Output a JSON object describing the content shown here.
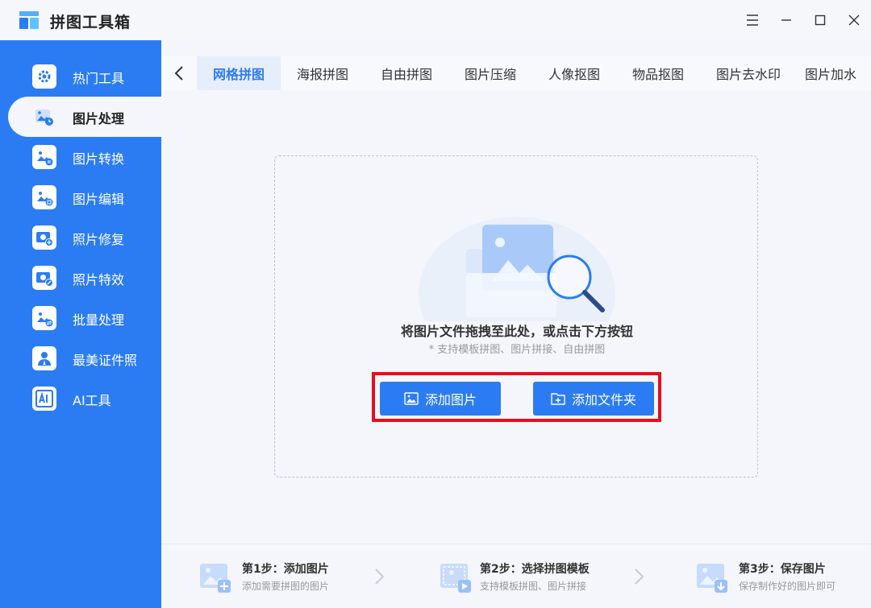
{
  "app": {
    "title": "拼图工具箱",
    "accent_color": "#2b7cf3",
    "highlight_color": "#e3101c"
  },
  "window_controls": [
    {
      "name": "menu-icon"
    },
    {
      "name": "minimize-icon"
    },
    {
      "name": "maximize-icon"
    },
    {
      "name": "close-icon"
    }
  ],
  "sidebar": {
    "items": [
      {
        "label": "热门工具",
        "icon": "gear-icon",
        "active": false
      },
      {
        "label": "图片处理",
        "icon": "image-process-icon",
        "active": true
      },
      {
        "label": "图片转换",
        "icon": "image-convert-icon",
        "active": false
      },
      {
        "label": "图片编辑",
        "icon": "image-edit-icon",
        "active": false
      },
      {
        "label": "照片修复",
        "icon": "photo-repair-icon",
        "active": false
      },
      {
        "label": "照片特效",
        "icon": "photo-effect-icon",
        "active": false
      },
      {
        "label": "批量处理",
        "icon": "batch-icon",
        "active": false
      },
      {
        "label": "最美证件照",
        "icon": "id-photo-icon",
        "active": false
      },
      {
        "label": "AI工具",
        "icon": "ai-icon",
        "active": false
      }
    ]
  },
  "tabs": {
    "items": [
      {
        "label": "网格拼图",
        "active": true
      },
      {
        "label": "海报拼图",
        "active": false
      },
      {
        "label": "自由拼图",
        "active": false
      },
      {
        "label": "图片压缩",
        "active": false
      },
      {
        "label": "人像抠图",
        "active": false
      },
      {
        "label": "物品抠图",
        "active": false
      },
      {
        "label": "图片去水印",
        "active": false
      },
      {
        "label": "图片加水",
        "active": false
      }
    ]
  },
  "dropzone": {
    "main_text": "将图片文件拖拽至此处，或点击下方按钮",
    "sub_text": "* 支持模板拼图、图片拼接、自由拼图",
    "add_image_label": "添加图片",
    "add_folder_label": "添加文件夹"
  },
  "steps": [
    {
      "title": "第1步：添加图片",
      "desc": "添加需要拼图的图片",
      "icon": "add-image-step-icon"
    },
    {
      "title": "第2步：选择拼图模板",
      "desc": "支持模板拼图、图片拼接",
      "icon": "template-step-icon"
    },
    {
      "title": "第3步：保存图片",
      "desc": "保存制作好的图片即可",
      "icon": "save-step-icon"
    }
  ]
}
